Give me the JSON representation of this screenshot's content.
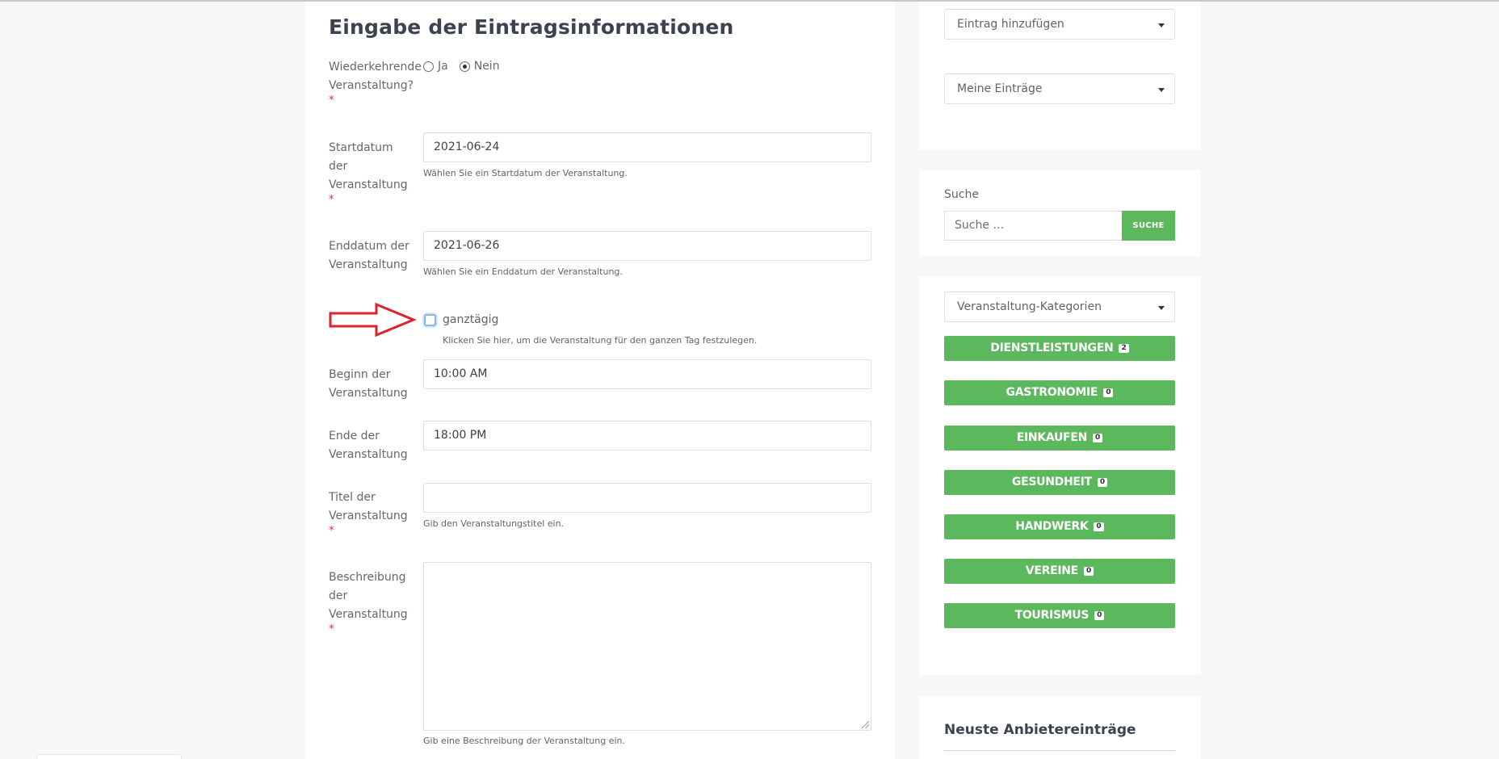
{
  "form": {
    "title": "Eingabe der Eintragsinformationen",
    "recurring": {
      "label": "Wiederkehrende Veranstaltung?",
      "required_mark": "*",
      "options": [
        "Ja",
        "Nein"
      ],
      "selected": "Nein"
    },
    "start_date": {
      "label": "Startdatum der Veranstaltung",
      "required_mark": "*",
      "value": "2021-06-24",
      "help": "Wählen Sie ein Startdatum der Veranstaltung."
    },
    "end_date": {
      "label": "Enddatum der Veranstaltung",
      "value": "2021-06-26",
      "help": "Wählen Sie ein Enddatum der Veranstaltung."
    },
    "all_day": {
      "label": "ganztägig",
      "checked": false,
      "help": "Klicken Sie hier, um die Veranstaltung für den ganzen Tag festzulegen."
    },
    "begin_time": {
      "label": "Beginn der Veranstaltung",
      "value": "10:00 AM"
    },
    "end_time": {
      "label": "Ende der Veranstaltung",
      "value": "18:00 PM"
    },
    "event_title": {
      "label": "Titel der Veranstaltung",
      "required_mark": "*",
      "value": "",
      "help": "Gib den Veranstaltungstitel ein."
    },
    "description": {
      "label": "Beschreibung der Veranstaltung",
      "required_mark": "*",
      "value": "",
      "help": "Gib eine Beschreibung der Veranstaltung ein."
    }
  },
  "sidebar": {
    "add_entry_select": "Eintrag hinzufügen",
    "my_entries_select": "Meine Einträge",
    "search": {
      "label": "Suche",
      "placeholder": "Suche …",
      "button": "SUCHE"
    },
    "categories_select": "Veranstaltung-Kategorien",
    "categories": [
      {
        "name": "DIENSTLEISTUNGEN",
        "count": "2"
      },
      {
        "name": "GASTRONOMIE",
        "count": "0"
      },
      {
        "name": "EINKAUFEN",
        "count": "0"
      },
      {
        "name": "GESUNDHEIT",
        "count": "0"
      },
      {
        "name": "HANDWERK",
        "count": "0"
      },
      {
        "name": "VEREINE",
        "count": "0"
      },
      {
        "name": "TOURISMUS",
        "count": "0"
      }
    ],
    "recent_title": "Neuste Anbietereinträge"
  },
  "colors": {
    "accent_green": "#5cb85c",
    "required_red": "#e0313a",
    "arrow_red": "#d9232d",
    "focus_blue": "#86b7e8"
  },
  "icons": [
    "chevron-down-icon",
    "red-arrow-annotation-icon"
  ]
}
